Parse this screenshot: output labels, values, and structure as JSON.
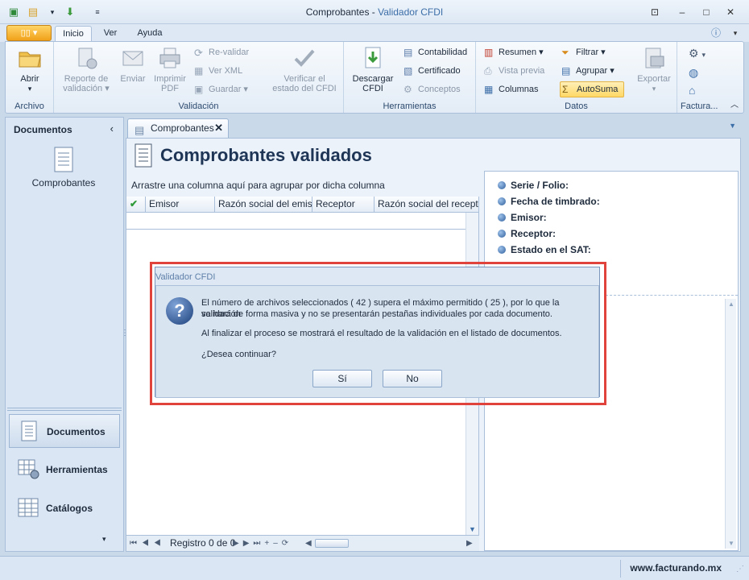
{
  "window": {
    "title_prefix": "Comprobantes",
    "title_sep": " - ",
    "title_app": "Validador CFDI"
  },
  "ribbon_tabs": {
    "inicio": "Inicio",
    "ver": "Ver",
    "ayuda": "Ayuda"
  },
  "groups": {
    "archivo": {
      "label": "Archivo",
      "abrir": "Abrir"
    },
    "validacion": {
      "label": "Validación",
      "reporte1": "Reporte de",
      "reporte2": "validación",
      "enviar": "Enviar",
      "imprimir1": "Imprimir",
      "imprimir2": "PDF",
      "revalidar": "Re-validar",
      "verxml": "Ver XML",
      "guardar": "Guardar",
      "verificar1": "Verificar el",
      "verificar2": "estado del CFDI"
    },
    "herramientas": {
      "label": "Herramientas",
      "descargar1": "Descargar",
      "descargar2": "CFDI",
      "contabilidad": "Contabilidad",
      "certificado": "Certificado",
      "conceptos": "Conceptos"
    },
    "datos": {
      "label": "Datos",
      "resumen": "Resumen",
      "vistaprevia": "Vista previa",
      "columnas": "Columnas",
      "filtrar": "Filtrar",
      "agrupar": "Agrupar",
      "autosuma": "AutoSuma",
      "exportar": "Exportar"
    },
    "factura": {
      "label": "Factura..."
    }
  },
  "left_pane": {
    "title": "Documentos",
    "item": "Comprobantes",
    "nav": [
      "Documentos",
      "Herramientas",
      "Catálogos"
    ]
  },
  "doc": {
    "tab": "Comprobantes",
    "heading": "Comprobantes validados",
    "group_hint": "Arrastre una columna aquí para agrupar por dicha columna",
    "columns": [
      "Emisor",
      "Razón social del emisor",
      "Receptor",
      "Razón social del receptor"
    ],
    "record": "Registro 0 de 0"
  },
  "detail": {
    "fields": [
      "Serie / Folio:",
      "Fecha de timbrado:",
      "Emisor:",
      "Receptor:",
      "Estado en el SAT:"
    ]
  },
  "dialog": {
    "title": "Validador CFDI",
    "line1": "El número de archivos seleccionados ( 42 ) supera el máximo permitido ( 25 ), por lo que la validación",
    "line2": "se hará de forma masiva y no se presentarán pestañas individuales por cada documento.",
    "line3": "Al finalizar el proceso se mostrará el resultado de la validación en el listado de documentos.",
    "line4": "¿Desea continuar?",
    "yes": "Sí",
    "no": "No"
  },
  "status": {
    "site": "www.facturando.mx"
  }
}
